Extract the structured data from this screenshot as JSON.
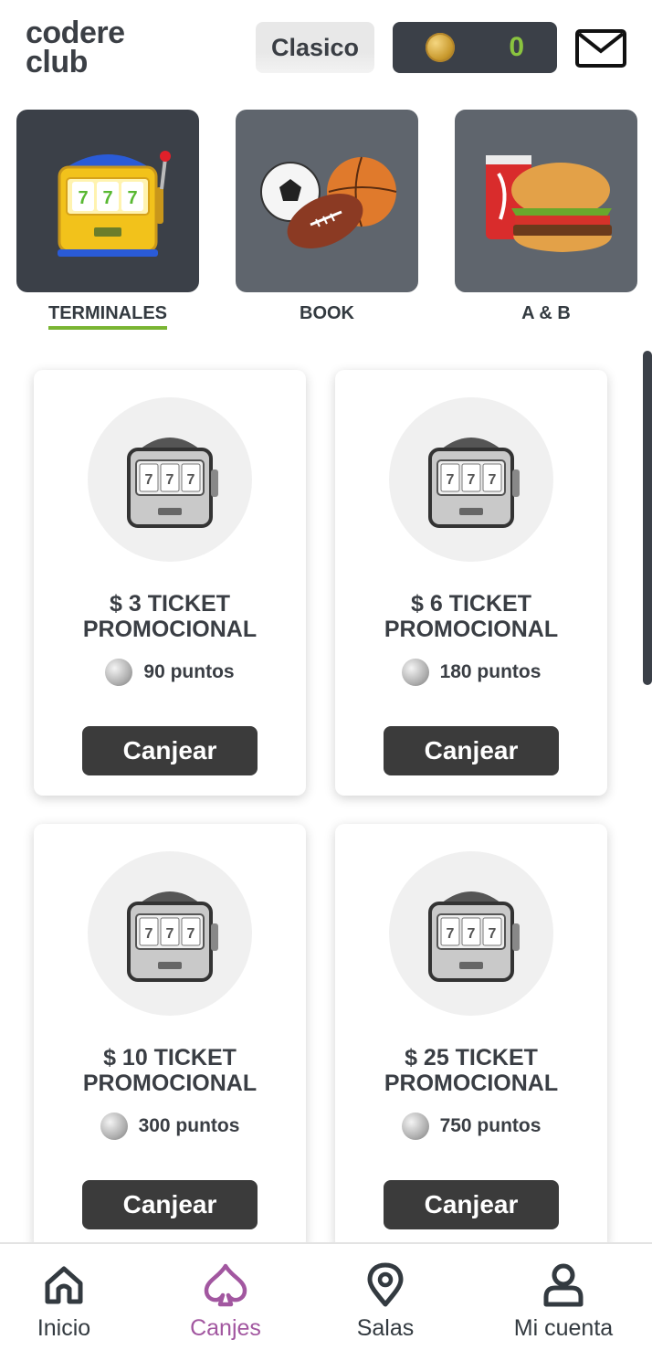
{
  "header": {
    "logo_line1": "codere",
    "logo_line2": "club",
    "tier": "Clasico",
    "points": "0"
  },
  "categories": [
    {
      "label": "TERMINALES",
      "active": true
    },
    {
      "label": "BOOK",
      "active": false
    },
    {
      "label": "A & B",
      "active": false
    }
  ],
  "rewards": [
    {
      "title_line1": "$ 3 TICKET",
      "title_line2": "PROMOCIONAL",
      "points": "90 puntos",
      "button": "Canjear"
    },
    {
      "title_line1": "$ 6 TICKET",
      "title_line2": "PROMOCIONAL",
      "points": "180 puntos",
      "button": "Canjear"
    },
    {
      "title_line1": "$ 10 TICKET",
      "title_line2": "PROMOCIONAL",
      "points": "300 puntos",
      "button": "Canjear"
    },
    {
      "title_line1": "$ 25 TICKET",
      "title_line2": "PROMOCIONAL",
      "points": "750 puntos",
      "button": "Canjear"
    }
  ],
  "nav": [
    {
      "label": "Inicio",
      "icon": "home-icon"
    },
    {
      "label": "Canjes",
      "icon": "spade-icon"
    },
    {
      "label": "Salas",
      "icon": "location-pin-icon"
    },
    {
      "label": "Mi cuenta",
      "icon": "user-icon"
    }
  ],
  "colors": {
    "accent_green": "#8ac43f",
    "active_nav": "#a257a0",
    "dark": "#3b4048"
  }
}
